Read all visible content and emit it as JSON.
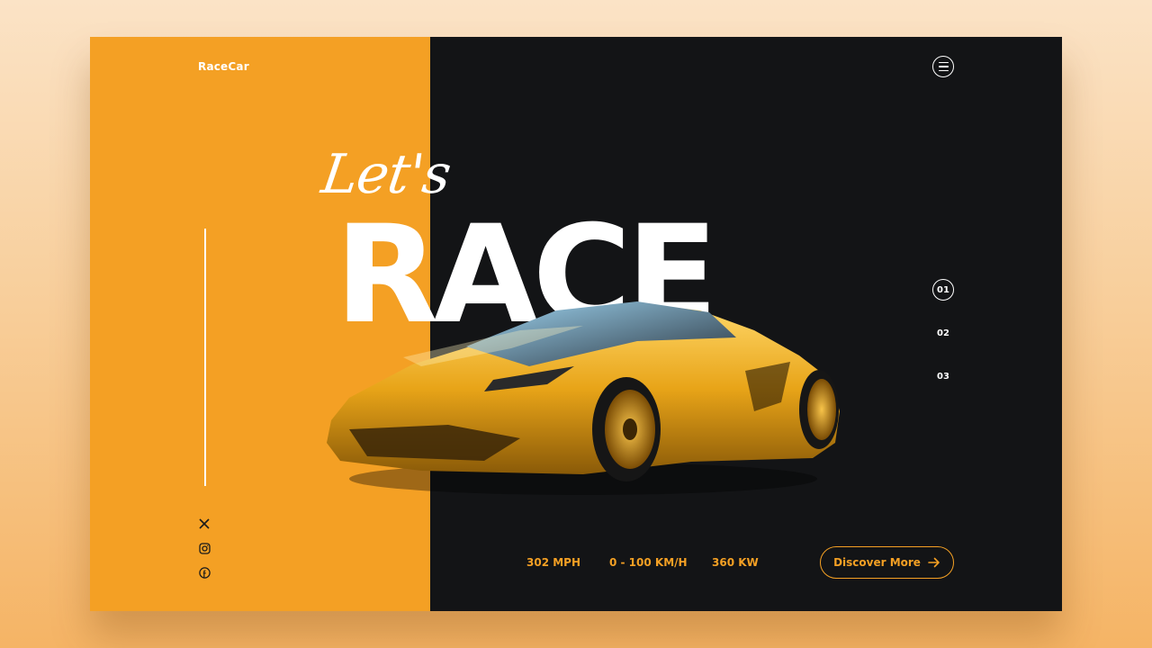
{
  "brand": {
    "name": "RaceCar"
  },
  "hero": {
    "script_text": "Let's",
    "headline": "RACE"
  },
  "pagination": {
    "items": [
      "01",
      "02",
      "03"
    ],
    "active_index": 0
  },
  "stats": [
    {
      "label": "302 MPH"
    },
    {
      "label": "0 - 100 KM/H"
    },
    {
      "label": "360 KW"
    }
  ],
  "cta": {
    "label": "Discover More",
    "icon": "arrow-right-icon"
  },
  "social": [
    "x-icon",
    "instagram-icon",
    "facebook-icon"
  ],
  "header": {
    "menu_icon": "hamburger-menu-icon"
  },
  "colors": {
    "accent": "#f4a024",
    "dark": "#131416",
    "text": "#ffffff"
  }
}
